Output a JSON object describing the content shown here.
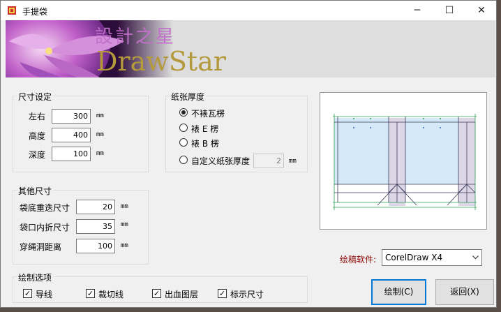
{
  "window": {
    "title": "手提袋",
    "controls": [
      "─",
      "☐",
      "✕"
    ]
  },
  "banner": {
    "logo_cn": "設計之星",
    "logo_en": "DrawStar"
  },
  "size": {
    "title": "尺寸设定",
    "fields": [
      {
        "label": "左右",
        "value": "300",
        "unit": "mm"
      },
      {
        "label": "高度",
        "value": "400",
        "unit": "mm"
      },
      {
        "label": "深度",
        "value": "100",
        "unit": "mm"
      }
    ]
  },
  "paper": {
    "title": "纸张厚度",
    "options": [
      {
        "label": "不裱瓦楞",
        "selected": true
      },
      {
        "label": "裱 E 楞",
        "selected": false
      },
      {
        "label": "裱 B 楞",
        "selected": false
      },
      {
        "label": "自定义纸张厚度",
        "selected": false
      }
    ],
    "custom_value": "2",
    "custom_unit": "mm"
  },
  "other": {
    "title": "其他尺寸",
    "fields": [
      {
        "label": "袋底重迭尺寸",
        "value": "20",
        "unit": "mm"
      },
      {
        "label": "袋口内折尺寸",
        "value": "35",
        "unit": "mm"
      },
      {
        "label": "穿绳洞距离",
        "value": "100",
        "unit": "mm"
      }
    ]
  },
  "draw": {
    "title": "绘制选项",
    "options": [
      {
        "label": "导线",
        "checked": true
      },
      {
        "label": "裁切线",
        "checked": true
      },
      {
        "label": "出血图层",
        "checked": true
      },
      {
        "label": "标示尺寸",
        "checked": true
      }
    ]
  },
  "software": {
    "label": "绘稿软件:",
    "selected": "CorelDraw X4"
  },
  "buttons": {
    "draw": "绘制(C)",
    "back": "返回(X)"
  },
  "colors": {
    "accent": "#0078d7",
    "label_red": "#8b0000",
    "preview_fill": "#d4e8f8",
    "gusset": "#ddd6e6",
    "line_green": "#2e9b57"
  }
}
